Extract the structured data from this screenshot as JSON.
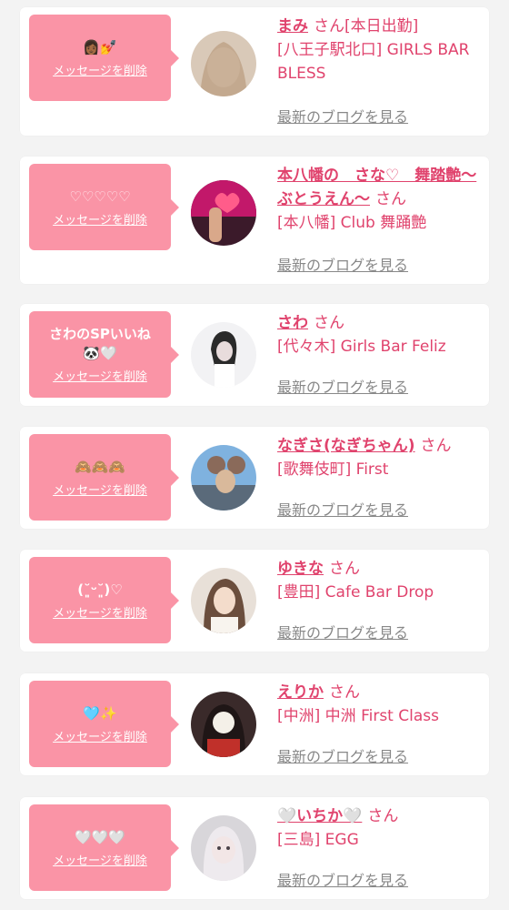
{
  "entries": [
    {
      "message": "👩🏾💅",
      "delete_label": "メッセージを削除",
      "name": "まみ",
      "san": "さん",
      "extra": "[本日出勤]",
      "shop": "[八王子駅北口] GIRLS BAR BLESS",
      "blog_link": "最新のブログを見る",
      "avatar_colors": [
        "#d9c9b8",
        "#b99b7e",
        "#f0e4d6"
      ]
    },
    {
      "message": "♡♡♡♡♡",
      "delete_label": "メッセージを削除",
      "name": "本八幡の　さな♡　舞踏艶〜ぶとうえん〜",
      "san": "さん",
      "extra": "",
      "shop": "[本八幡] Club 舞踊艶",
      "blog_link": "最新のブログを見る",
      "avatar_colors": [
        "#c2186a",
        "#ff5c8a",
        "#3b1a2a"
      ]
    },
    {
      "message": "さわのSPいいね🐼🤍",
      "delete_label": "メッセージを削除",
      "name": "さわ",
      "san": "さん",
      "extra": "",
      "shop": "[代々木] Girls Bar Feliz",
      "blog_link": "最新のブログを見る",
      "avatar_colors": [
        "#f2f2f4",
        "#2a2a2a",
        "#e8dcdc"
      ]
    },
    {
      "message": "🙈🙈🙈",
      "delete_label": "メッセージを削除",
      "name": "なぎさ(なぎちゃん)",
      "san": "さん",
      "extra": "",
      "shop": "[歌舞伎町] First",
      "blog_link": "最新のブログを見る",
      "avatar_colors": [
        "#7fb2df",
        "#8a6a5a",
        "#d9b99b"
      ]
    },
    {
      "message": "(˘͈ᵕ˘͈)♡",
      "delete_label": "メッセージを削除",
      "name": "ゆきな",
      "san": "さん",
      "extra": "",
      "shop": "[豊田] Cafe Bar Drop",
      "blog_link": "最新のブログを見る",
      "avatar_colors": [
        "#e8e0d8",
        "#6b4e3d",
        "#f3dccb"
      ]
    },
    {
      "message": "🩵✨",
      "delete_label": "メッセージを削除",
      "name": "えりか",
      "san": "さん",
      "extra": "",
      "shop": "[中洲] 中洲 First Class",
      "blog_link": "最新のブログを見る",
      "avatar_colors": [
        "#3a2a2a",
        "#c0302a",
        "#f4f0e8"
      ]
    },
    {
      "message": "🤍🤍🤍",
      "delete_label": "メッセージを削除",
      "name": "🤍いちか🤍",
      "san": "さん",
      "extra": "",
      "shop": "[三島] EGG",
      "blog_link": "最新のブログを見る",
      "avatar_colors": [
        "#d8d6da",
        "#4a4248",
        "#f2e6e6"
      ]
    }
  ]
}
